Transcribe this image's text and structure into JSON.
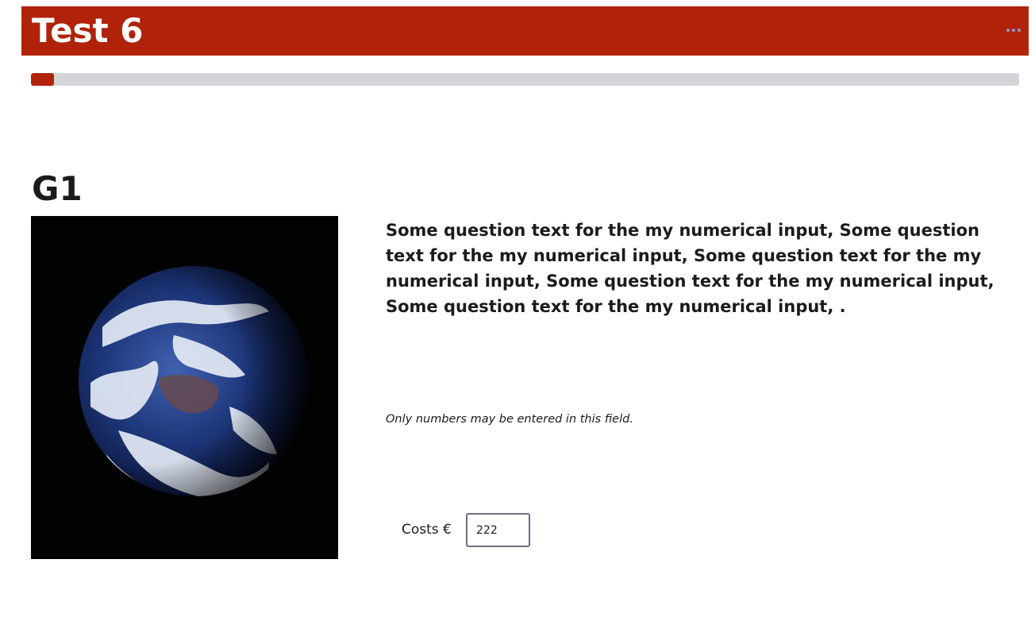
{
  "header": {
    "title": "Test 6",
    "menu_icon": "more-horizontal-icon",
    "color": "#b0230a"
  },
  "progress": {
    "percent": 2.3
  },
  "group": {
    "title": "G1"
  },
  "question": {
    "image_icon": "earth-image",
    "text": "Some question text for the my numerical input, Some question text for the my numerical input, Some question text for the my numerical input, Some question text for the my numerical input, Some question text for the my numerical input, .",
    "hint": "Only numbers may be entered in this field.",
    "answer_label": "Costs €",
    "answer_value": "222"
  }
}
